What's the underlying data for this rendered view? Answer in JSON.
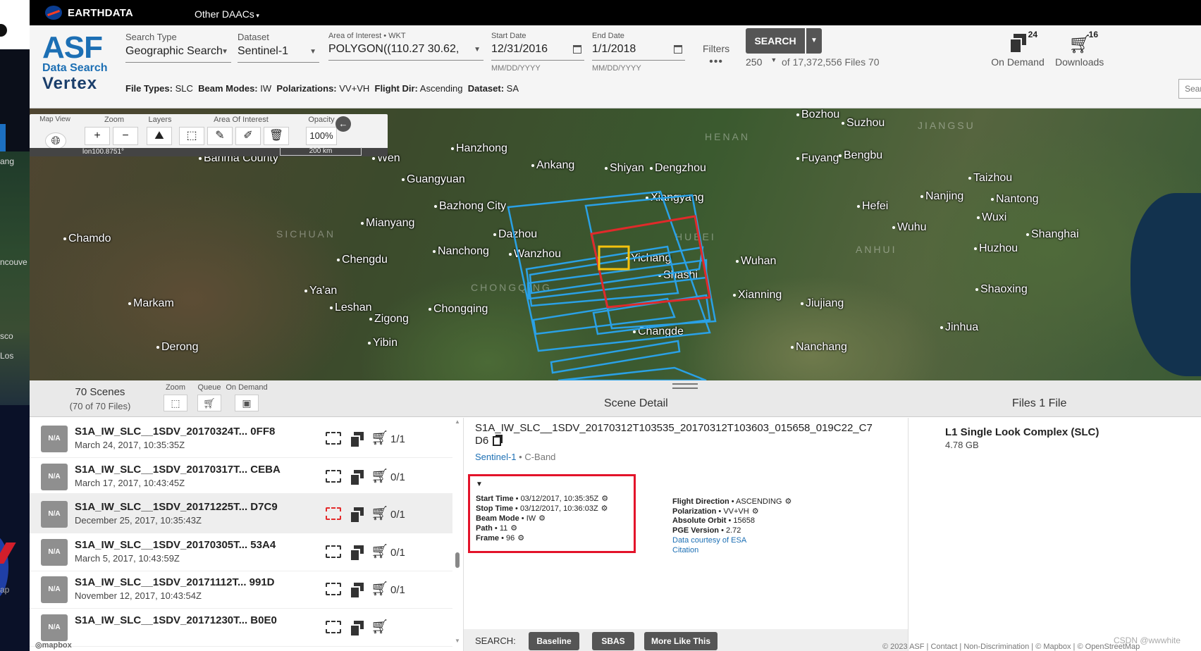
{
  "earthdata": {
    "brand": "EARTHDATA",
    "other_daacs": "Other DAACs"
  },
  "logo": {
    "asf": "ASF",
    "data_search": "Data Search",
    "vertex": "Vertex"
  },
  "search_type": {
    "label": "Search Type",
    "value": "Geographic Search"
  },
  "dataset": {
    "label": "Dataset",
    "value": "Sentinel-1"
  },
  "aoi": {
    "label": "Area of Interest • WKT",
    "value": "POLYGON((110.27 30.62,"
  },
  "start_date": {
    "label": "Start Date",
    "value": "12/31/2016",
    "hint": "MM/DD/YYYY"
  },
  "end_date": {
    "label": "End Date",
    "value": "1/1/2018",
    "hint": "MM/DD/YYYY"
  },
  "filters": {
    "label": "Filters",
    "dots": "•••"
  },
  "search_button": "SEARCH",
  "max_results": "250",
  "results_summary": "of 17,372,556 Files 70",
  "on_demand": {
    "label": "On Demand",
    "count": "24"
  },
  "downloads": {
    "label": "Downloads",
    "count": "16"
  },
  "filter_summary": [
    {
      "key": "File Types:",
      "value": "SLC"
    },
    {
      "key": "Beam Modes:",
      "value": "IW"
    },
    {
      "key": "Polarizations:",
      "value": "VV+VH"
    },
    {
      "key": "Flight Dir:",
      "value": "Ascending"
    },
    {
      "key": "Dataset:",
      "value": "SA"
    }
  ],
  "mini_search": "Sear",
  "map_toolbar": {
    "map_view": "Map View",
    "zoom": "Zoom",
    "layers": "Layers",
    "aoi": "Area Of Interest",
    "opacity": "Opacity",
    "opacity_value": "100%",
    "lon": "lon100.8751°",
    "scale": "200 km"
  },
  "map_places": [
    {
      "name": "Hanzhong"
    },
    {
      "name": "Ankang"
    },
    {
      "name": "Shiyan"
    },
    {
      "name": "Dengzhou"
    },
    {
      "name": "Bozhou"
    },
    {
      "name": "Suzhou"
    },
    {
      "name": "Wen"
    },
    {
      "name": "Banma County"
    },
    {
      "name": "Guangyuan"
    },
    {
      "name": "Bazhong City"
    },
    {
      "name": "Xiangyang"
    },
    {
      "name": "Fuyang"
    },
    {
      "name": "Bengbu"
    },
    {
      "name": "Taizhou"
    },
    {
      "name": "Nanjing"
    },
    {
      "name": "Nantong"
    },
    {
      "name": "Hefei"
    },
    {
      "name": "Wuxi"
    },
    {
      "name": "Wuhu"
    },
    {
      "name": "Shanghai"
    },
    {
      "name": "Mianyang"
    },
    {
      "name": "Dazhou"
    },
    {
      "name": "Chamdo"
    },
    {
      "name": "Nanchong"
    },
    {
      "name": "Wanzhou"
    },
    {
      "name": "Yichang"
    },
    {
      "name": "Shashi"
    },
    {
      "name": "Wuhan"
    },
    {
      "name": "Huzhou"
    },
    {
      "name": "Chengdu"
    },
    {
      "name": "Ya'an"
    },
    {
      "name": "Markam"
    },
    {
      "name": "Leshan"
    },
    {
      "name": "Chongqing"
    },
    {
      "name": "Zigong"
    },
    {
      "name": "Xianning"
    },
    {
      "name": "Jiujiang"
    },
    {
      "name": "Shaoxing"
    },
    {
      "name": "Jinhua"
    },
    {
      "name": "Changde"
    },
    {
      "name": "Yibin"
    },
    {
      "name": "Nanchang"
    },
    {
      "name": "Derong"
    }
  ],
  "map_regions": [
    "HENAN",
    "JIANGSU",
    "SICHUAN",
    "HUBEI",
    "ANHUI",
    "CHONGQING"
  ],
  "list_header": {
    "count": "70 Scenes",
    "sub": "(70 of 70 Files)",
    "tools": [
      "Zoom",
      "Queue",
      "On Demand"
    ],
    "scene_detail": "Scene Detail",
    "files": "Files 1 File"
  },
  "scenes": [
    {
      "thumb": "N/A",
      "title": "S1A_IW_SLC__1SDV_20170324T... 0FF8",
      "date": "March 24, 2017, 10:35:35Z",
      "count": "1/1",
      "selected": false
    },
    {
      "thumb": "N/A",
      "title": "S1A_IW_SLC__1SDV_20170317T... CEBA",
      "date": "March 17, 2017, 10:43:45Z",
      "count": "0/1",
      "selected": false
    },
    {
      "thumb": "N/A",
      "title": "S1A_IW_SLC__1SDV_20171225T... D7C9",
      "date": "December 25, 2017, 10:35:43Z",
      "count": "0/1",
      "selected": true
    },
    {
      "thumb": "N/A",
      "title": "S1A_IW_SLC__1SDV_20170305T... 53A4",
      "date": "March 5, 2017, 10:43:59Z",
      "count": "0/1",
      "selected": false
    },
    {
      "thumb": "N/A",
      "title": "S1A_IW_SLC__1SDV_20171112T... 991D",
      "date": "November 12, 2017, 10:43:54Z",
      "count": "0/1",
      "selected": false
    },
    {
      "thumb": "N/A",
      "title": "S1A_IW_SLC__1SDV_20171230T... B0E0",
      "date": "",
      "count": "",
      "selected": false
    }
  ],
  "detail": {
    "name": "S1A_IW_SLC__1SDV_20170312T103535_20170312T103603_015658_019C22_C7D6",
    "dataset": "Sentinel-1",
    "band": "• C-Band",
    "toggle": "▼",
    "left_meta": [
      {
        "key": "Start Time",
        "value": "03/12/2017, 10:35:35Z"
      },
      {
        "key": "Stop Time",
        "value": "03/12/2017, 10:36:03Z"
      },
      {
        "key": "Beam Mode",
        "value": "IW"
      },
      {
        "key": "Path",
        "value": "11"
      },
      {
        "key": "Frame",
        "value": "96"
      }
    ],
    "right_meta": [
      {
        "key": "Flight Direction",
        "value": "ASCENDING"
      },
      {
        "key": "Polarization",
        "value": "VV+VH"
      },
      {
        "key": "Absolute Orbit",
        "value": "15658"
      },
      {
        "key": "PGE Version",
        "value": "2.72"
      }
    ],
    "courtesy": "Data courtesy of ESA",
    "citation": "Citation",
    "search_label": "SEARCH:",
    "buttons": [
      "Baseline",
      "SBAS",
      "More Like This"
    ]
  },
  "file": {
    "name": "L1 Single Look Complex (SLC)",
    "size": "4.78 GB"
  },
  "footer": "© 2023 ASF | Contact | Non-Discrimination | © Mapbox | © OpenStreetMap",
  "watermark": "CSDN @wwwhite",
  "mapbox": "◎mapbox",
  "left_window": {
    "texts": [
      "ang",
      "ncouve",
      "sco",
      "Los",
      "ap"
    ]
  },
  "colors": {
    "accent": "#1c6fb4",
    "highlight": "#e3132a",
    "footprint": "#2aa1e6",
    "selected_footprint": "#e02a2a",
    "aoi": "#f4c20d"
  }
}
